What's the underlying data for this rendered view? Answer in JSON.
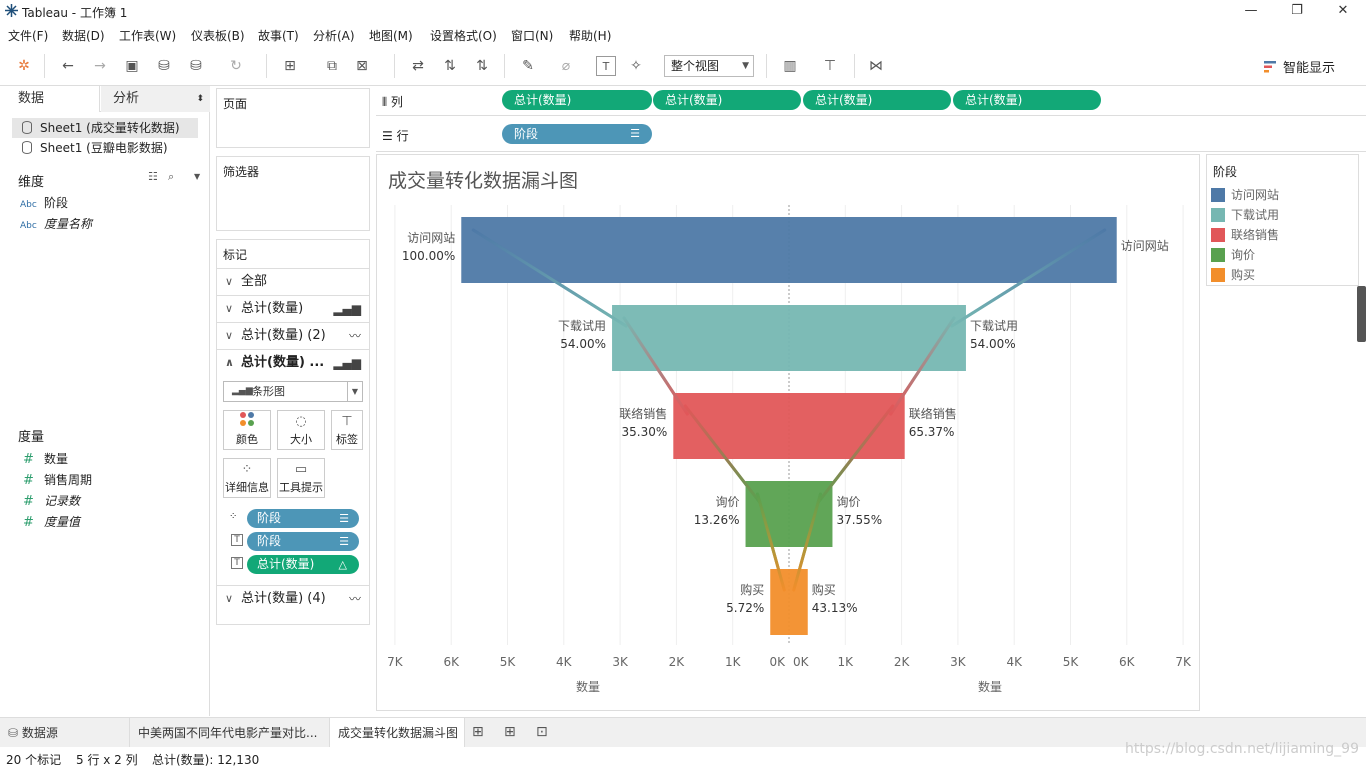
{
  "window": {
    "title": "Tableau - 工作簿 1",
    "minimize": "—",
    "restore": "❐",
    "close": "✕"
  },
  "menu": [
    "文件(F)",
    "数据(D)",
    "工作表(W)",
    "仪表板(B)",
    "故事(T)",
    "分析(A)",
    "地图(M)",
    "设置格式(O)",
    "窗口(N)",
    "帮助(H)"
  ],
  "toolbar": {
    "view_select": "整个视图",
    "smart_show": "智能显示"
  },
  "left": {
    "tab_data": "数据",
    "tab_analysis": "分析",
    "datasources": [
      "Sheet1 (成交量转化数据)",
      "Sheet1 (豆瓣电影数据)"
    ],
    "dimensions_title": "维度",
    "dimensions": [
      {
        "type": "Abc",
        "name": "阶段",
        "italic": false
      },
      {
        "type": "Abc",
        "name": "度量名称",
        "italic": true
      }
    ],
    "measures_title": "度量",
    "measures": [
      {
        "name": "数量",
        "italic": false
      },
      {
        "name": "销售周期",
        "italic": false
      },
      {
        "name": "记录数",
        "italic": true
      },
      {
        "name": "度量值",
        "italic": true
      }
    ]
  },
  "cards": {
    "pages": "页面",
    "filters": "筛选器",
    "marks": "标记",
    "mark_rows": [
      "全部",
      "总计(数量)",
      "总计(数量) (2)",
      "总计(数量) ...",
      "总计(数量) (4)"
    ],
    "mark_type": "条形图",
    "mark_buttons": [
      "颜色",
      "大小",
      "标签",
      "详细信息",
      "工具提示"
    ],
    "mark_pills": [
      "阶段",
      "阶段",
      "总计(数量)"
    ]
  },
  "shelves": {
    "columns_label": "列",
    "rows_label": "行",
    "columns": [
      "总计(数量)",
      "总计(数量)",
      "总计(数量)",
      "总计(数量)"
    ],
    "rows": [
      "阶段"
    ]
  },
  "chart_data": {
    "type": "bar",
    "title": "成交量转化数据漏斗图",
    "categories": [
      "访问网站",
      "下载试用",
      "联络销售",
      "询价",
      "购买"
    ],
    "values": [
      5821,
      3143,
      2055,
      772,
      333
    ],
    "colors": [
      "#4e79a7",
      "#76b7b2",
      "#e15759",
      "#59a14f",
      "#f28e2b"
    ],
    "left_labels": [
      "100.00%",
      "54.00%",
      "35.30%",
      "13.26%",
      "5.72%"
    ],
    "right_labels": [
      "",
      "54.00%",
      "65.37%",
      "37.55%",
      "43.13%"
    ],
    "xticks_left": [
      "7K",
      "6K",
      "5K",
      "4K",
      "3K",
      "2K",
      "1K",
      "0K"
    ],
    "xticks_right": [
      "0K",
      "1K",
      "2K",
      "3K",
      "4K",
      "5K",
      "6K",
      "7K"
    ],
    "xlabel": "数量",
    "xlim": [
      0,
      7000
    ],
    "grid": true
  },
  "legend": {
    "title": "阶段"
  },
  "sheettabs": [
    "数据源",
    "中美两国不同年代电影产量对比...",
    "成交量转化数据漏斗图"
  ],
  "status": {
    "marks": "20 个标记",
    "rowscols": "5 行 x 2 列",
    "sum": "总计(数量): 12,130"
  },
  "watermark": "https://blog.csdn.net/lijiaming_99"
}
